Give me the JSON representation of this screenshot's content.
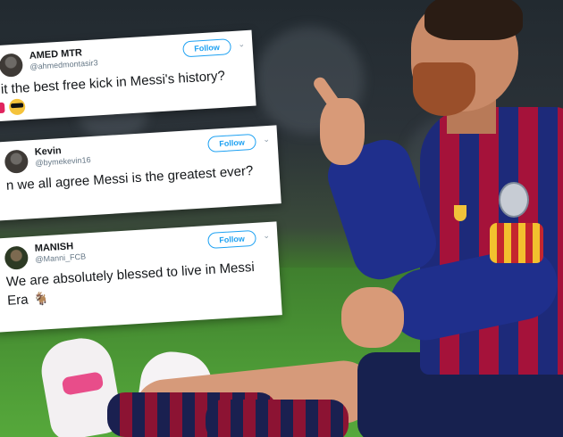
{
  "tweets": [
    {
      "name": "AMED MTR",
      "handle": "@ahmedmontasir3",
      "follow_label": "Follow",
      "text": "it the best free kick in Messi's history?",
      "emoji": "cool-face"
    },
    {
      "name": "Kevin",
      "handle": "@bymekevin16",
      "follow_label": "Follow",
      "text": "n we all agree Messi is the greatest ever?"
    },
    {
      "name": "MANISH",
      "handle": "@Manni_FCB",
      "follow_label": "Follow",
      "text": "We are absolutely blessed to live in Messi Era",
      "emoji": "goat"
    }
  ],
  "emoji_glyphs": {
    "goat": "🐐"
  },
  "colors": {
    "follow_blue": "#1da1f2",
    "barca_blue": "#1d2a7a",
    "barca_red": "#a5123a",
    "captain_band": "#f2c12e"
  },
  "icons": {
    "dropdown": "chevron-down-icon",
    "avatar": "avatar"
  }
}
